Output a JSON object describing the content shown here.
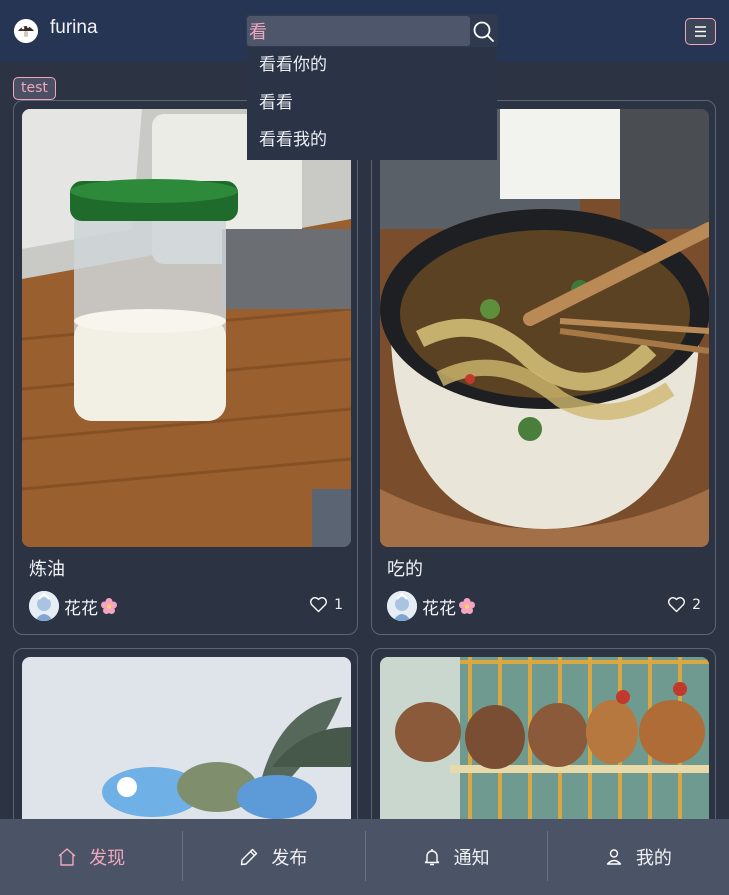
{
  "header": {
    "app_name": "furina",
    "search": {
      "value": "看",
      "placeholder": ""
    },
    "suggestions": [
      "看看你的",
      "看看",
      "看看我的"
    ]
  },
  "tag": "test",
  "posts": [
    {
      "title": "炼油",
      "author": "花花",
      "likes": "1"
    },
    {
      "title": "吃的",
      "author": "花花",
      "likes": "2"
    },
    {
      "title": "",
      "author": "",
      "likes": ""
    },
    {
      "title": "",
      "author": "",
      "likes": ""
    }
  ],
  "nav": [
    {
      "label": "发现",
      "icon": "home-icon",
      "active": true
    },
    {
      "label": "发布",
      "icon": "pencil-icon",
      "active": false
    },
    {
      "label": "通知",
      "icon": "bell-icon",
      "active": false
    },
    {
      "label": "我的",
      "icon": "user-icon",
      "active": false
    }
  ],
  "colors": {
    "header_bg": "#263553",
    "page_bg": "#2c3444",
    "accent": "#f0a7be",
    "nav_bg": "#4b5467"
  }
}
